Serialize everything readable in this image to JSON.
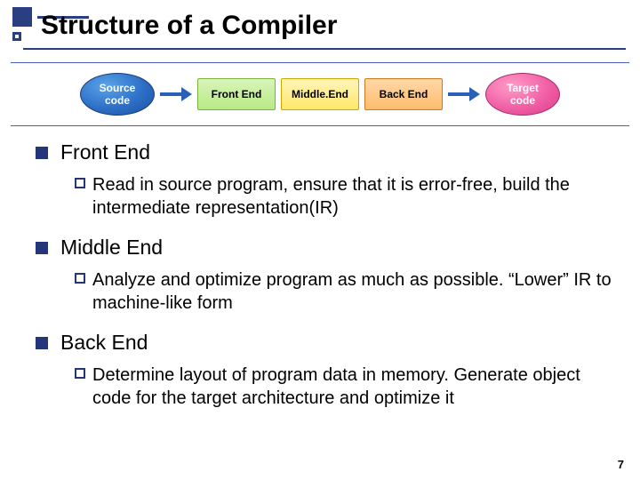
{
  "title": "Structure of a Compiler",
  "diagram": {
    "source": "Source\ncode",
    "front": "Front End",
    "middle": "Middle.End",
    "back": "Back End",
    "target": "Target\ncode"
  },
  "sections": [
    {
      "heading": "Front End",
      "sub": "Read in source program, ensure that it is error-free, build the intermediate representation(IR)"
    },
    {
      "heading": "Middle End",
      "sub": "Analyze and optimize program as much as possible. “Lower” IR to machine-like form"
    },
    {
      "heading": "Back End",
      "sub": "Determine layout of program data in memory. Generate object code for the target architecture and optimize it"
    }
  ],
  "page_number": "7"
}
